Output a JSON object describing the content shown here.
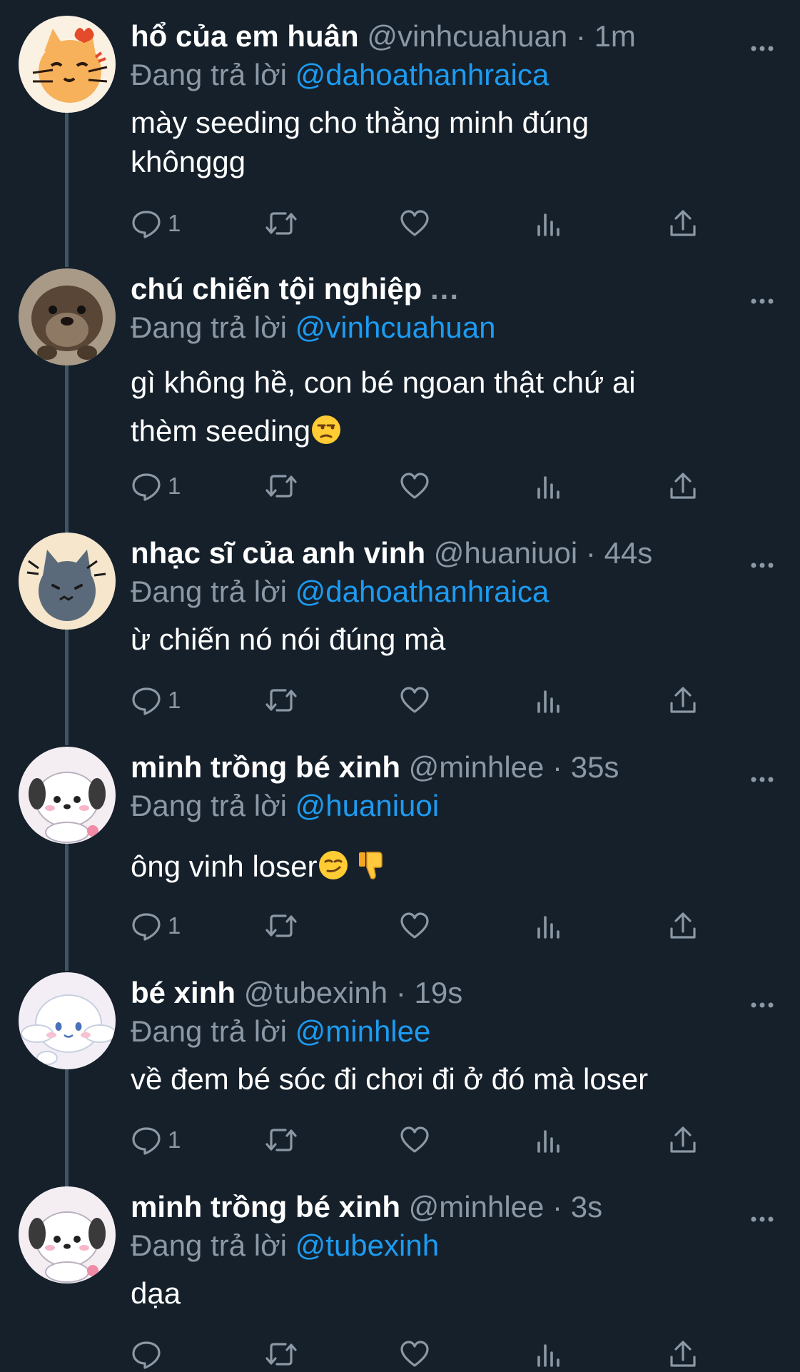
{
  "replying_prefix": "Đang trả lời",
  "tweets": [
    {
      "display_name": "hổ của em huân",
      "handle": "@vinhcuahuan",
      "separator": "·",
      "time": "1m",
      "reply_to": "@dahoathanhraica",
      "text_lines": [
        "mày seeding cho thằng minh đúng",
        "khônggg"
      ],
      "reply_count": "1"
    },
    {
      "display_name": "chú chiến tội nghiệp",
      "name_ellipsis": "...",
      "reply_to": "@vinhcuahuan",
      "text_lines": [
        "gì không hề, con bé ngoan thật chứ ai",
        "thèm seeding"
      ],
      "reply_count": "1"
    },
    {
      "display_name": "nhạc sĩ của anh vinh",
      "handle": "@huaniuoi",
      "separator": "·",
      "time": "44s",
      "reply_to": "@dahoathanhraica",
      "text_lines": [
        "ừ chiến nó nói đúng mà"
      ],
      "reply_count": "1"
    },
    {
      "display_name": "minh trồng bé xinh",
      "handle": "@minhlee",
      "separator": "·",
      "time": "35s",
      "reply_to": "@huaniuoi",
      "text_lines": [
        "ông vinh loser"
      ],
      "reply_count": "1"
    },
    {
      "display_name": "bé xinh",
      "handle": "@tubexinh",
      "separator": "·",
      "time": "19s",
      "reply_to": "@minhlee",
      "text_lines": [
        "về đem bé sóc đi chơi đi ở đó mà loser"
      ],
      "reply_count": "1"
    },
    {
      "display_name": "minh trồng bé xinh",
      "handle": "@minhlee",
      "separator": "·",
      "time": "3s",
      "reply_to": "@tubexinh",
      "text_lines": [
        "dạa"
      ],
      "reply_count": ""
    }
  ],
  "icons": {
    "reply": "reply-icon",
    "retweet": "retweet-icon",
    "like": "heart-icon",
    "views": "views-icon",
    "share": "share-icon",
    "more": "more-icon"
  },
  "colors": {
    "background": "#15202b",
    "text": "#ffffff",
    "muted": "#8b98a5",
    "link": "#1d9bf0",
    "thread_line": "#3d5466"
  }
}
